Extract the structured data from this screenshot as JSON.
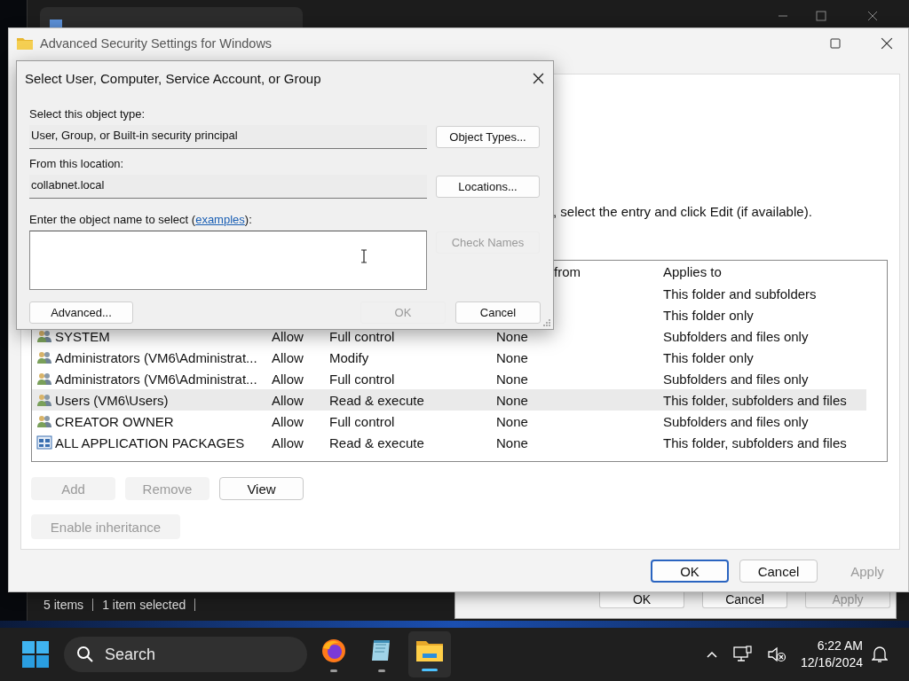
{
  "explorer": {
    "status_bar": [
      "5 items",
      "1 item selected"
    ]
  },
  "properties_dialog": {
    "buttons": [
      {
        "label": "OK",
        "disabled": false
      },
      {
        "label": "Cancel",
        "disabled": false
      },
      {
        "label": "Apply",
        "disabled": true
      }
    ]
  },
  "security_window": {
    "title": "Advanced Security Settings for Windows",
    "instruction": ", select the entry and click Edit (if available).",
    "table": {
      "headers": {
        "inherited_from": "from",
        "applies_to": "Applies to"
      },
      "rows": [
        {
          "applies_to": "This folder and subfolders",
          "selected": false
        },
        {
          "applies_to": "This folder only",
          "selected": false
        },
        {
          "kind": "group",
          "principal": "SYSTEM",
          "type": "Allow",
          "access": "Full control",
          "inherited_from": "None",
          "applies_to": "Subfolders and files only",
          "selected": false
        },
        {
          "kind": "group",
          "principal": "Administrators (VM6\\Administrat...",
          "type": "Allow",
          "access": "Modify",
          "inherited_from": "None",
          "applies_to": "This folder only",
          "selected": false
        },
        {
          "kind": "group",
          "principal": "Administrators (VM6\\Administrat...",
          "type": "Allow",
          "access": "Full control",
          "inherited_from": "None",
          "applies_to": "Subfolders and files only",
          "selected": false
        },
        {
          "kind": "group",
          "principal": "Users (VM6\\Users)",
          "type": "Allow",
          "access": "Read & execute",
          "inherited_from": "None",
          "applies_to": "This folder, subfolders and files",
          "selected": true
        },
        {
          "kind": "group",
          "principal": "CREATOR OWNER",
          "type": "Allow",
          "access": "Full control",
          "inherited_from": "None",
          "applies_to": "Subfolders and files only",
          "selected": false
        },
        {
          "kind": "package",
          "principal": "ALL APPLICATION PACKAGES",
          "type": "Allow",
          "access": "Read & execute",
          "inherited_from": "None",
          "applies_to": "This folder, subfolders and files",
          "selected": false
        }
      ]
    },
    "entry_buttons": [
      {
        "label": "Add",
        "disabled": true
      },
      {
        "label": "Remove",
        "disabled": true
      },
      {
        "label": "View",
        "disabled": false
      }
    ],
    "inheritance_button": {
      "label": "Enable inheritance",
      "disabled": true
    },
    "footer_buttons": [
      {
        "label": "OK",
        "disabled": false,
        "default": true
      },
      {
        "label": "Cancel",
        "disabled": false,
        "default": false
      },
      {
        "label": "Apply",
        "disabled": true,
        "default": false
      }
    ]
  },
  "select_dialog": {
    "title": "Select User, Computer, Service Account, or Group",
    "object_type_label": "Select this object type:",
    "object_type": "User, Group, or Built-in security principal",
    "object_types_button": {
      "label": "Object Types...",
      "disabled": false
    },
    "location_label": "From this location:",
    "location": "collabnet.local",
    "locations_button": {
      "label": "Locations...",
      "disabled": false
    },
    "name_label_before": "Enter the object name to select (",
    "name_label_link": "examples",
    "name_label_after": "):",
    "check_names_button": {
      "label": "Check Names",
      "disabled": true
    },
    "advanced_button": {
      "label": "Advanced...",
      "disabled": false
    },
    "ok_button": {
      "label": "OK",
      "disabled": true
    },
    "cancel_button": {
      "label": "Cancel",
      "disabled": false
    }
  },
  "taskbar": {
    "search_placeholder": "Search",
    "apps": [
      {
        "kind": "firefox",
        "active": false
      },
      {
        "kind": "notepad",
        "active": false
      },
      {
        "kind": "explorer",
        "active": true
      }
    ],
    "time": "6:22 AM",
    "date": "12/16/2024"
  }
}
